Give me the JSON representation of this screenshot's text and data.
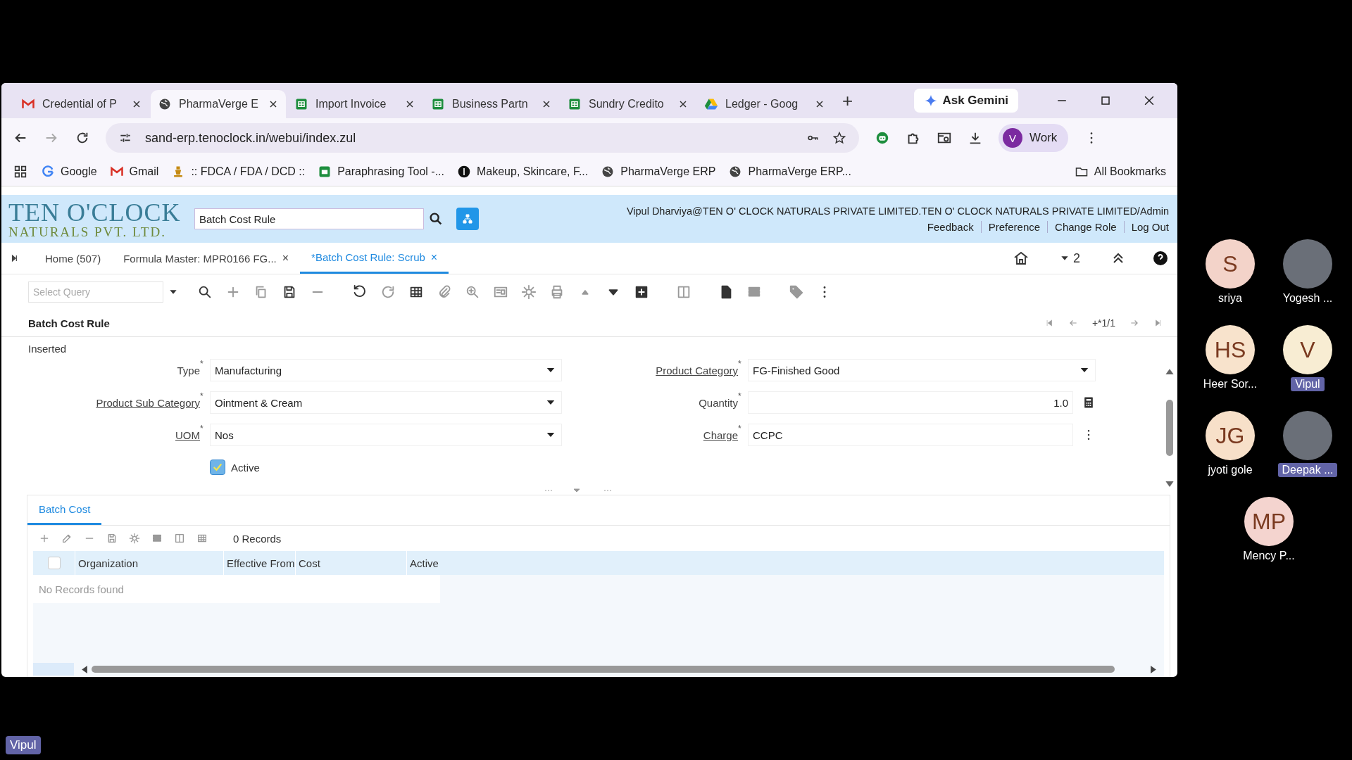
{
  "browser": {
    "tabs": [
      {
        "title": "Credential of P",
        "kind": "gmail",
        "selected": false
      },
      {
        "title": "PharmaVerge E",
        "kind": "globe",
        "selected": true
      },
      {
        "title": "Import Invoice",
        "kind": "sheets",
        "selected": false
      },
      {
        "title": "Business Partn",
        "kind": "sheets",
        "selected": false
      },
      {
        "title": "Sundry Credito",
        "kind": "sheets",
        "selected": false
      },
      {
        "title": "Ledger - Goog",
        "kind": "drive",
        "selected": false
      }
    ],
    "new_tab": "+",
    "gemini": "Ask Gemini",
    "url": "sand-erp.tenoclock.in/webui/index.zul",
    "profile": {
      "initial": "V",
      "label": "Work"
    },
    "bookmarks": [
      {
        "label": "Google",
        "kind": "google"
      },
      {
        "label": "Gmail",
        "kind": "gmail"
      },
      {
        "label": ":: FDCA / FDA / DCD ::",
        "kind": "emblem"
      },
      {
        "label": "Paraphrasing Tool -...",
        "kind": "app"
      },
      {
        "label": "Makeup, Skincare, F...",
        "kind": "dot"
      },
      {
        "label": "PharmaVerge ERP",
        "kind": "globe"
      },
      {
        "label": "PharmaVerge ERP...",
        "kind": "globe"
      }
    ],
    "all_bookmarks": "All Bookmarks"
  },
  "app": {
    "logo": {
      "top": "TEN O'CLOCK",
      "bottom": "NATURALS PVT. LTD."
    },
    "search": {
      "value": "Batch Cost Rule"
    },
    "user": "Vipul Dharviya@TEN O' CLOCK NATURALS PRIVATE LIMITED.TEN O' CLOCK NATURALS PRIVATE LIMITED/Admin",
    "links": [
      "Feedback",
      "Preference",
      "Change Role",
      "Log Out"
    ],
    "tabs": [
      {
        "label": "Home (507)",
        "selected": false,
        "closable": false
      },
      {
        "label": "Formula Master: MPR0166 FG...",
        "selected": false,
        "closable": true
      },
      {
        "label": "*Batch Cost Rule: Scrub",
        "selected": true,
        "closable": true
      }
    ],
    "close_mark": "×",
    "tab_count": "2",
    "query": {
      "placeholder": "Select Query"
    },
    "window_title": "Batch Cost Rule",
    "record_nav": "+*1/1",
    "status": "Inserted",
    "fields": [
      {
        "label": "Type",
        "link": false,
        "kind": "dropdown",
        "value": "Manufacturing"
      },
      {
        "label": "Product Category",
        "link": true,
        "kind": "dropdown",
        "value": "FG-Finished Good"
      },
      {
        "label": "Product Sub Category",
        "link": true,
        "kind": "dropdown",
        "value": "Ointment & Cream"
      },
      {
        "label": "Quantity",
        "link": false,
        "kind": "number",
        "value": "1.0"
      },
      {
        "label": "UOM",
        "link": true,
        "kind": "dropdown",
        "value": "Nos"
      },
      {
        "label": "Charge",
        "link": true,
        "kind": "search",
        "value": "CCPC"
      }
    ],
    "required_mark": "*",
    "active": {
      "label": "Active",
      "checked": true
    },
    "subtabs": [
      {
        "label": "Batch Cost",
        "selected": true
      }
    ],
    "records": "0 Records",
    "select_all": {
      "checked": false
    },
    "columns": [
      "Organization",
      "Effective From",
      "Cost",
      "Active"
    ],
    "empty": "No Records found"
  },
  "participants": [
    {
      "name": "sriya",
      "kind": "initials",
      "initials": "S",
      "color": "#f3d3c9",
      "highlighted": false
    },
    {
      "name": "Yogesh ...",
      "kind": "photo",
      "highlighted": false
    },
    {
      "name": "Heer Sor...",
      "kind": "initials",
      "initials": "HS",
      "color": "#f8e3cc",
      "highlighted": false
    },
    {
      "name": "Vipul",
      "kind": "initials",
      "initials": "V",
      "color": "#f8edd3",
      "highlighted": true
    },
    {
      "name": "jyoti gole",
      "kind": "initials",
      "initials": "JG",
      "color": "#f7e0c9",
      "highlighted": false
    },
    {
      "name": "Deepak ...",
      "kind": "photo",
      "highlighted": true
    },
    {
      "name": "Mency P...",
      "kind": "initials",
      "initials": "MP",
      "color": "#f4d4cf",
      "highlighted": false
    }
  ],
  "presenter": "Vipul"
}
